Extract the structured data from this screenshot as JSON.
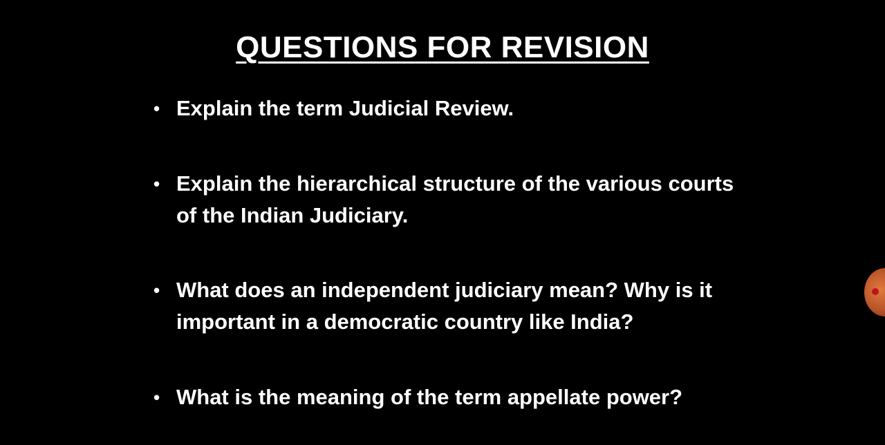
{
  "slide": {
    "title": "QUESTIONS FOR REVISION",
    "bullet_glyph": "•",
    "questions": [
      "Explain the term Judicial Review.",
      "Explain the hierarchical structure of the various courts of the Indian Judiciary.",
      "What does an independent judiciary mean? Why is it important in a democratic country like India?",
      "What is the meaning of the term appellate power?"
    ]
  },
  "colors": {
    "background": "#000000",
    "text": "#ffffff",
    "floating_bubble": "#c8612f"
  }
}
